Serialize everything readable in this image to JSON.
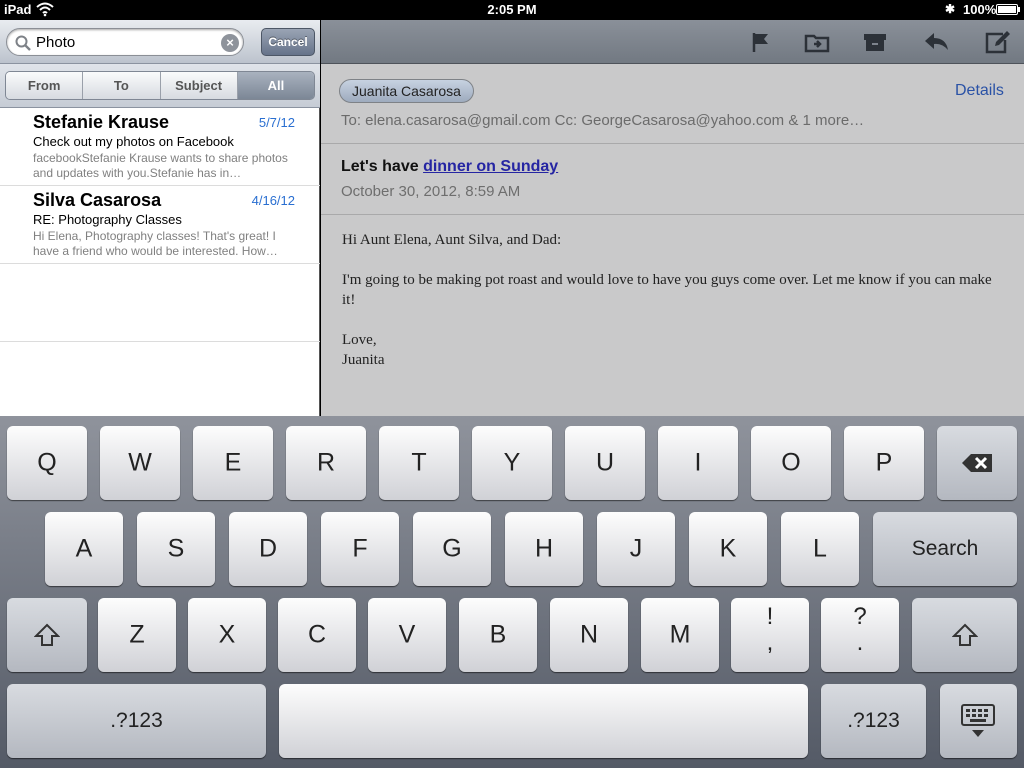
{
  "status_bar": {
    "carrier": "iPad",
    "time": "2:05 PM",
    "battery": "100%"
  },
  "search": {
    "query": "Photo",
    "cancel_label": "Cancel",
    "scopes": [
      "From",
      "To",
      "Subject",
      "All"
    ],
    "selected_scope": "All"
  },
  "messages": [
    {
      "sender": "Stefanie Krause",
      "date": "5/7/12",
      "subject": "Check out my photos on Facebook",
      "preview": "facebookStefanie Krause wants to share photos and updates with you.Stefanie has in…"
    },
    {
      "sender": "Silva Casarosa",
      "date": "4/16/12",
      "subject": "RE: Photography Classes",
      "preview": "Hi Elena, Photography classes! That's great! I have a friend who would be interested. How…"
    }
  ],
  "toolbar": {
    "icons": [
      "flag-icon",
      "move-to-folder-icon",
      "archive-icon",
      "reply-icon",
      "compose-icon"
    ]
  },
  "email": {
    "from": "Juanita Casarosa",
    "details_label": "Details",
    "to_line": "To: elena.casarosa@gmail.com   Cc: GeorgeCasarosa@yahoo.com & 1 more…",
    "subject_prefix": "Let's have ",
    "subject_link": "dinner on Sunday",
    "date": "October 30, 2012, 8:59 AM",
    "body": [
      "Hi Aunt Elena, Aunt Silva, and Dad:",
      "I'm going to be making pot roast and would love to have you guys come over. Let me know if you can make it!",
      "Love,",
      "Juanita"
    ]
  },
  "keyboard": {
    "row1": [
      "Q",
      "W",
      "E",
      "R",
      "T",
      "Y",
      "U",
      "I",
      "O",
      "P"
    ],
    "row2": [
      "A",
      "S",
      "D",
      "F",
      "G",
      "H",
      "J",
      "K",
      "L"
    ],
    "row3": [
      "Z",
      "X",
      "C",
      "V",
      "B",
      "N",
      "M"
    ],
    "search_label": "Search",
    "punct1": {
      "top": "!",
      "bottom": ","
    },
    "punct2": {
      "top": "?",
      "bottom": "."
    },
    "numbers_label": ".?123"
  }
}
